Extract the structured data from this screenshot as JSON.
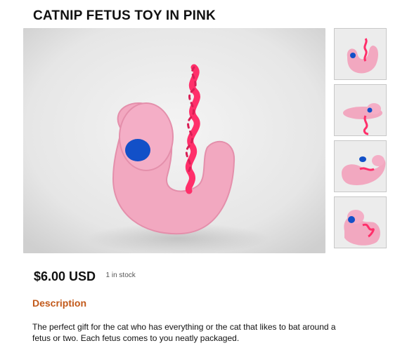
{
  "product": {
    "title": "CATNIP FETUS TOY IN PINK",
    "price": "$6.00 USD",
    "stock": "1 in stock",
    "description_heading": "Description",
    "description_text": "The perfect gift for the cat who has everything or the cat that likes to bat around a fetus or two. Each fetus comes to you neatly packaged."
  },
  "images": {
    "main": "main product photo",
    "thumbnails": [
      "thumbnail 1",
      "thumbnail 2",
      "thumbnail 3",
      "thumbnail 4"
    ]
  },
  "colors": {
    "accent": "#c2591a",
    "toy_pink": "#f2a8c0",
    "yarn_red": "#ff2f6a",
    "eye_blue": "#1250c8"
  }
}
